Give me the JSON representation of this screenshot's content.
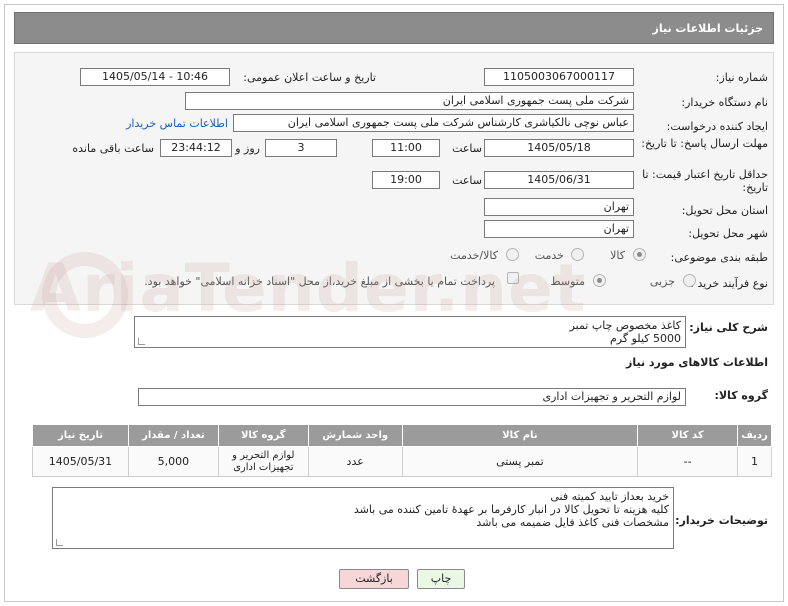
{
  "header": {
    "title": "جزئیات اطلاعات نیاز"
  },
  "fields": {
    "need_number_label": "شماره نیاز:",
    "need_number": "1105003067000117",
    "announce_label": "تاریخ و ساعت اعلان عمومی:",
    "announce_value": "1405/05/14 - 10:46",
    "buyer_org_label": "نام دستگاه خریدار:",
    "buyer_org": "شرکت ملی پست جمهوری اسلامی ایران",
    "creator_label": "ایجاد کننده درخواست:",
    "creator": "عباس نوچی نالکیاشری کارشناس شرکت ملی پست جمهوری اسلامی ایران",
    "contact_link": "اطلاعات تماس خریدار",
    "deadline_label": "مهلت ارسال پاسخ: تا تاریخ:",
    "deadline_date": "1405/05/18",
    "time_label": "ساعت",
    "deadline_time": "11:00",
    "days_value": "3",
    "days_label": "روز و",
    "remaining_time": "23:44:12",
    "remaining_label": "ساعت باقی مانده",
    "min_price_label": "حداقل تاریخ اعتبار قیمت: تا تاریخ:",
    "price_date": "1405/06/31",
    "price_time_label": "ساعت",
    "price_time": "19:00",
    "province_label": "استان محل تحویل:",
    "province": "تهران",
    "city_label": "شهر محل تحویل:",
    "city": "تهران",
    "category_label": "طبقه بندی موضوعی:",
    "category_options": [
      "کالا",
      "خدمت",
      "کالا/خدمت"
    ],
    "category_selected": "کالا",
    "process_label": "نوع فرآیند خرید :",
    "process_options": [
      "جزیی",
      "متوسط"
    ],
    "process_selected": "متوسط",
    "payment_note": "پرداخت تمام یا بخشی از مبلغ خرید،از محل \"اسناد خزانه اسلامی\" خواهد بود."
  },
  "description": {
    "label": "شرح کلی نیاز:",
    "line1": "کاغذ مخصوص چاپ تمبر",
    "line2": "5000 کیلو گرم"
  },
  "goods_section": {
    "title": "اطلاعات کالاهای مورد نیاز",
    "group_label": "گروه کالا:",
    "group_value": "لوازم التحریر و تجهیزات اداری"
  },
  "table": {
    "headers": [
      "ردیف",
      "کد کالا",
      "نام کالا",
      "واحد شمارش",
      "گروه کالا",
      "تعداد / مقدار",
      "تاریخ نیاز"
    ],
    "rows": [
      [
        "1",
        "--",
        "تمبر پستی",
        "عدد",
        "لوازم التحریر و تجهیزات اداری",
        "5,000",
        "1405/05/31"
      ]
    ]
  },
  "buyer_notes": {
    "label": "توضیحات خریدار:",
    "line1": "خرید بعداز تایید کمیته فنی",
    "line2": "کلیه هزینه تا تحویل کالا در انبار کارفرما بر عهدهٔ تامین کننده می باشد",
    "line3": "مشخصات فنی کاغذ فایل ضمیمه می باشد"
  },
  "buttons": {
    "print": "چاپ",
    "back": "بازگشت"
  },
  "colors": {
    "header_bg": "#8c8c8c",
    "link": "#1a5fb4",
    "back_btn_bg": "#f6d6d6",
    "print_btn_bg": "#e9f7e4"
  }
}
